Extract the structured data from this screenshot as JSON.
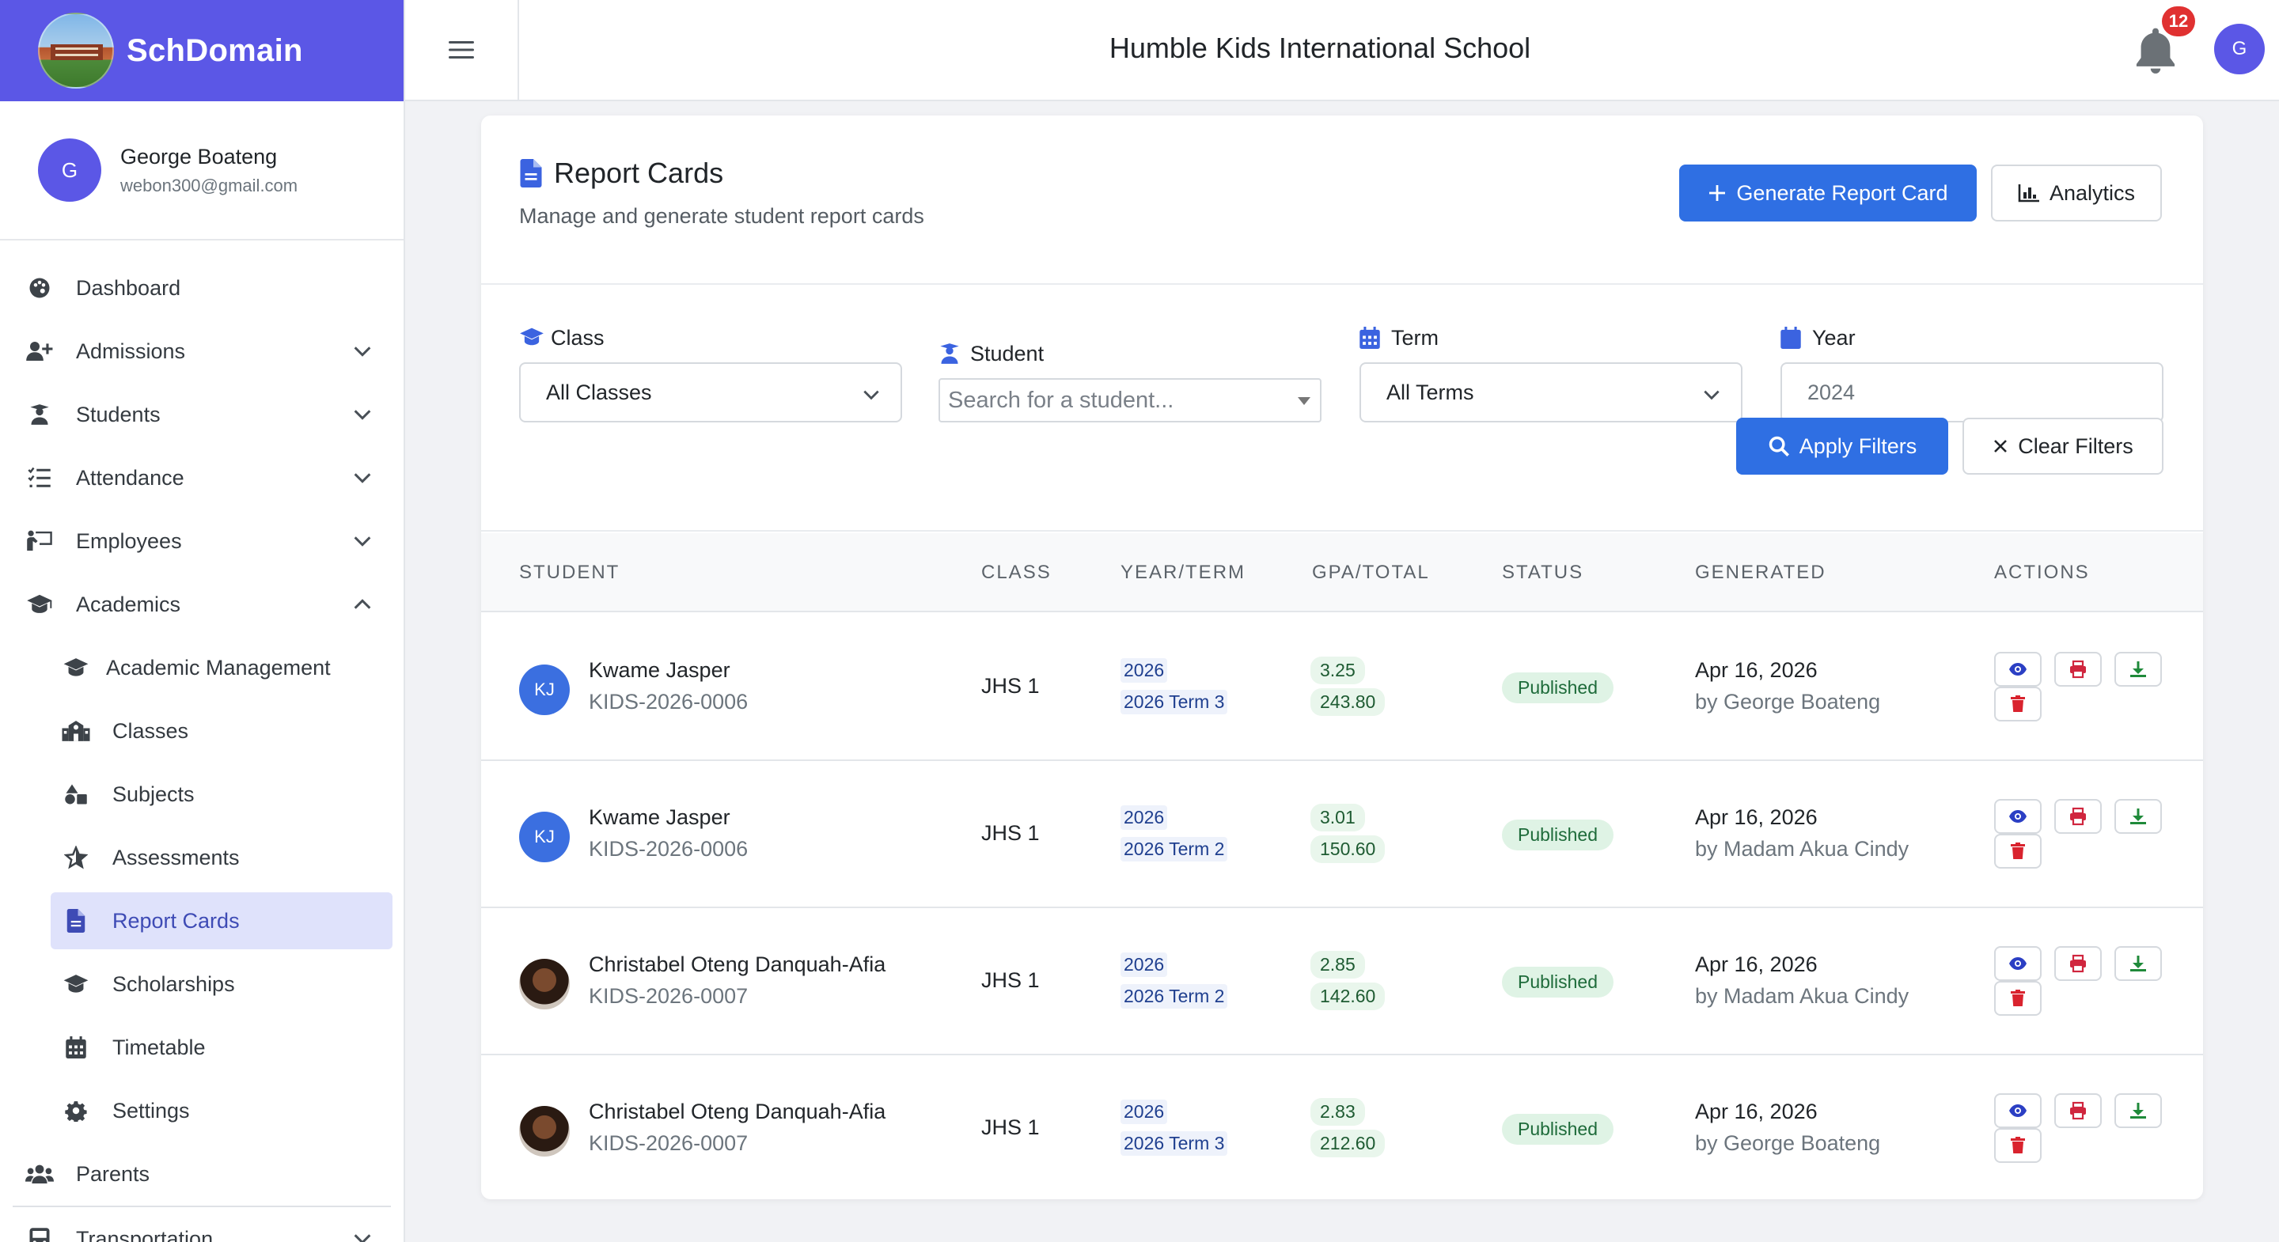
{
  "brand": {
    "name": "SchDomain"
  },
  "user": {
    "initial": "G",
    "name": "George Boateng",
    "email": "webon300@gmail.com"
  },
  "sidebar": {
    "items": [
      {
        "label": "Dashboard",
        "icon": "palette-icon"
      },
      {
        "label": "Admissions",
        "icon": "user-plus-icon"
      },
      {
        "label": "Students",
        "icon": "user-graduate-icon"
      },
      {
        "label": "Attendance",
        "icon": "list-check-icon"
      },
      {
        "label": "Employees",
        "icon": "person-chalkboard-icon"
      },
      {
        "label": "Academics",
        "icon": "graduation-cap-icon"
      }
    ],
    "sub_items": [
      {
        "label": "Academic Management",
        "icon": "graduation-cap-icon"
      },
      {
        "label": "Classes",
        "icon": "school-icon"
      },
      {
        "label": "Subjects",
        "icon": "shapes-icon"
      },
      {
        "label": "Assessments",
        "icon": "star-icon"
      },
      {
        "label": "Report Cards",
        "icon": "file-alt-icon",
        "active": true
      },
      {
        "label": "Scholarships",
        "icon": "graduation-cap-icon"
      },
      {
        "label": "Timetable",
        "icon": "calendar-icon"
      },
      {
        "label": "Settings",
        "icon": "gear-icon"
      }
    ],
    "parents": {
      "label": "Parents",
      "icon": "users-icon"
    },
    "transportation": {
      "label": "Transportation",
      "icon": "bus-icon"
    }
  },
  "topbar": {
    "school_name": "Humble Kids International School",
    "notifications": "12",
    "avatar_initial": "G"
  },
  "page": {
    "title": "Report Cards",
    "subtitle": "Manage and generate student report cards",
    "generate_label": "Generate Report Card",
    "analytics_label": "Analytics"
  },
  "filters": {
    "class_label": "Class",
    "class_value": "All Classes",
    "student_label": "Student",
    "student_placeholder": "Search for a student...",
    "term_label": "Term",
    "term_value": "All Terms",
    "year_label": "Year",
    "year_value": "2024",
    "apply_label": "Apply Filters",
    "clear_label": "Clear Filters"
  },
  "table": {
    "headers": [
      "STUDENT",
      "CLASS",
      "YEAR/TERM",
      "GPA/TOTAL",
      "STATUS",
      "GENERATED",
      "ACTIONS"
    ],
    "rows": [
      {
        "initials": "KJ",
        "photo": false,
        "name": "Kwame Jasper",
        "id": "KIDS-2026-0006",
        "class": "JHS 1",
        "year": "2026",
        "term": "2026 Term 3",
        "gpa": "3.25",
        "total": "243.80",
        "status": "Published",
        "date": "Apr 16, 2026",
        "by": "by George Boateng"
      },
      {
        "initials": "KJ",
        "photo": false,
        "name": "Kwame Jasper",
        "id": "KIDS-2026-0006",
        "class": "JHS 1",
        "year": "2026",
        "term": "2026 Term 2",
        "gpa": "3.01",
        "total": "150.60",
        "status": "Published",
        "date": "Apr 16, 2026",
        "by": "by Madam Akua Cindy"
      },
      {
        "initials": "",
        "photo": true,
        "name": "Christabel Oteng Danquah-Afia",
        "id": "KIDS-2026-0007",
        "class": "JHS 1",
        "year": "2026",
        "term": "2026 Term 2",
        "gpa": "2.85",
        "total": "142.60",
        "status": "Published",
        "date": "Apr 16, 2026",
        "by": "by Madam Akua Cindy"
      },
      {
        "initials": "",
        "photo": true,
        "name": "Christabel Oteng Danquah-Afia",
        "id": "KIDS-2026-0007",
        "class": "JHS 1",
        "year": "2026",
        "term": "2026 Term 3",
        "gpa": "2.83",
        "total": "212.60",
        "status": "Published",
        "date": "Apr 16, 2026",
        "by": "by George Boateng"
      }
    ]
  },
  "colors": {
    "brand": "#5b57e6",
    "primary": "#2f6fe3",
    "view": "#2b3fc4",
    "print": "#d0263e",
    "download": "#1f8a3a",
    "delete": "#d9232e"
  }
}
